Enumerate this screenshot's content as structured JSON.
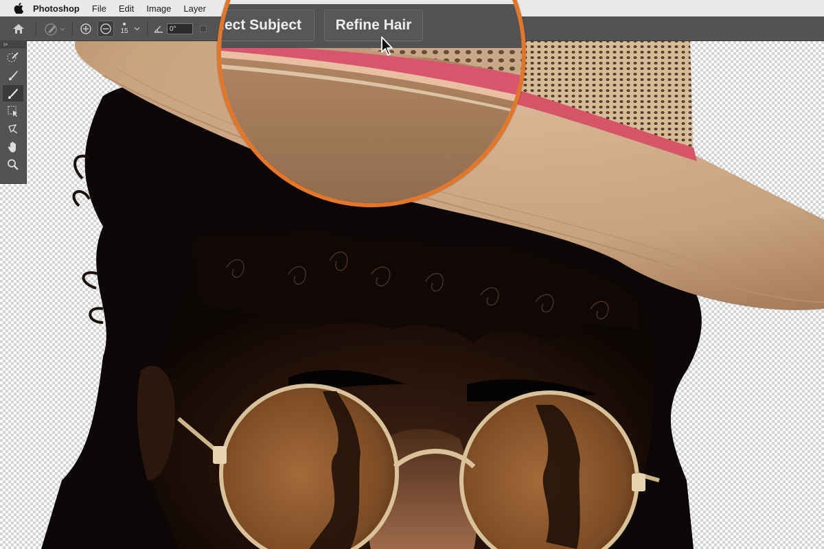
{
  "menubar": {
    "items": [
      "Photoshop",
      "File",
      "Edit",
      "Image",
      "Layer"
    ]
  },
  "options_bar": {
    "brush_size": "15",
    "angle": "0°"
  },
  "magnifier": {
    "select_subject_label": "lect Subject",
    "refine_hair_label": "Refine Hair"
  },
  "icons": [
    "apple-icon",
    "home-icon",
    "brush-preset-icon",
    "add-to-selection-icon",
    "subtract-from-selection-icon",
    "angle-icon",
    "quick-selection-icon",
    "refine-edge-brush-icon",
    "brush-icon",
    "object-selection-icon",
    "lasso-icon",
    "hand-icon",
    "zoom-icon",
    "cursor-arrow-icon"
  ],
  "colors": {
    "magnifier_border": "#e2772b",
    "panel": "#535353",
    "menubar": "#e9e9e9"
  }
}
